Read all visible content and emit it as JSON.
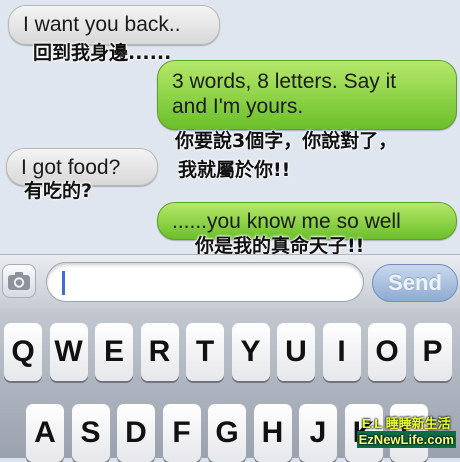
{
  "messages": [
    {
      "direction": "received",
      "text": "I want you back..",
      "caption": "回到我身邊......"
    },
    {
      "direction": "sent",
      "text_line1": "3 words, 8 letters. Say it",
      "text_line2": "and I'm yours.",
      "caption_line1": "你要說3個字，你說對了，",
      "caption_line2": "我就屬於你!!"
    },
    {
      "direction": "received",
      "text": "I got food?",
      "caption": "有吃的?"
    },
    {
      "direction": "sent",
      "text": "......you know me so well",
      "caption": "你是我的真命天子!!"
    }
  ],
  "composer": {
    "camera_icon": "camera-icon",
    "input_value": "",
    "send_label": "Send"
  },
  "keyboard": {
    "row1": [
      "Q",
      "W",
      "E",
      "R",
      "T",
      "Y",
      "U",
      "I",
      "O",
      "P"
    ],
    "row2": [
      "A",
      "S",
      "D",
      "F",
      "G",
      "H",
      "J",
      "K",
      "L"
    ]
  },
  "watermark": {
    "line1": "E.L 睡睡新生活",
    "line2": "EzNewLife.com"
  },
  "colors": {
    "sent_bubble": "#7cc637",
    "received_bubble": "#e9e9e9",
    "send_button": "#9db6d9"
  }
}
